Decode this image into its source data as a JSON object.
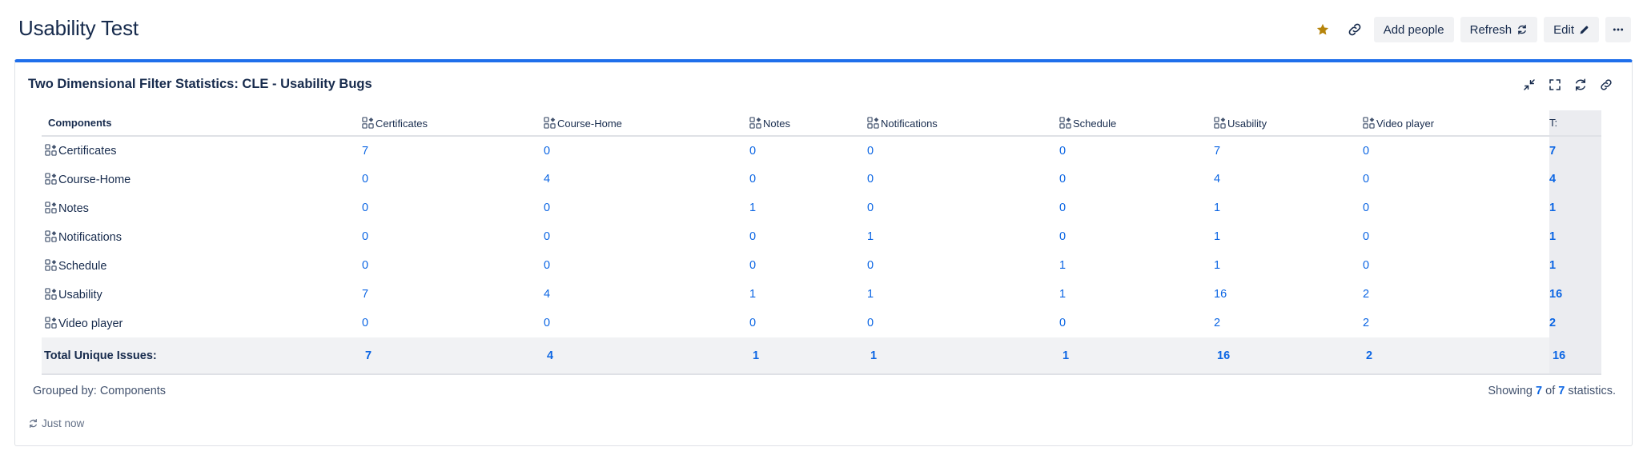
{
  "page": {
    "title": "Usability Test",
    "actions": {
      "add_people": "Add people",
      "refresh": "Refresh",
      "edit": "Edit"
    },
    "icons": {
      "star": "star-icon",
      "link": "link-icon",
      "refresh": "refresh-icon",
      "edit": "pencil-icon",
      "more": "more-icon"
    },
    "colors": {
      "accent": "#1f6feb",
      "link": "#0c66e4",
      "star": "#b6840a"
    }
  },
  "gadget": {
    "title": "Two Dimensional Filter Statistics: CLE - Usability Bugs",
    "tools": [
      "minimize-icon",
      "fullscreen-icon",
      "refresh-icon",
      "link-icon"
    ],
    "header_first": "Components",
    "columns": [
      "Certificates",
      "Course-Home",
      "Notes",
      "Notifications",
      "Schedule",
      "Usability",
      "Video player"
    ],
    "total_header": "T:",
    "rows": [
      {
        "label": "Certificates",
        "values": [
          "7",
          "0",
          "0",
          "0",
          "0",
          "7",
          "0"
        ],
        "total": "7"
      },
      {
        "label": "Course-Home",
        "values": [
          "0",
          "4",
          "0",
          "0",
          "0",
          "4",
          "0"
        ],
        "total": "4"
      },
      {
        "label": "Notes",
        "values": [
          "0",
          "0",
          "1",
          "0",
          "0",
          "1",
          "0"
        ],
        "total": "1"
      },
      {
        "label": "Notifications",
        "values": [
          "0",
          "0",
          "0",
          "1",
          "0",
          "1",
          "0"
        ],
        "total": "1"
      },
      {
        "label": "Schedule",
        "values": [
          "0",
          "0",
          "0",
          "0",
          "1",
          "1",
          "0"
        ],
        "total": "1"
      },
      {
        "label": "Usability",
        "values": [
          "7",
          "4",
          "1",
          "1",
          "1",
          "16",
          "2"
        ],
        "total": "16"
      },
      {
        "label": "Video player",
        "values": [
          "0",
          "0",
          "0",
          "0",
          "0",
          "2",
          "2"
        ],
        "total": "2"
      }
    ],
    "summary": {
      "label": "Total Unique Issues:",
      "values": [
        "7",
        "4",
        "1",
        "1",
        "1",
        "16",
        "2"
      ],
      "total": "16"
    },
    "grouped_by": "Grouped by: Components",
    "showing": {
      "prefix": "Showing",
      "shown": "7",
      "of": "of",
      "total": "7",
      "suffix": "statistics."
    },
    "updated": "Just now"
  }
}
